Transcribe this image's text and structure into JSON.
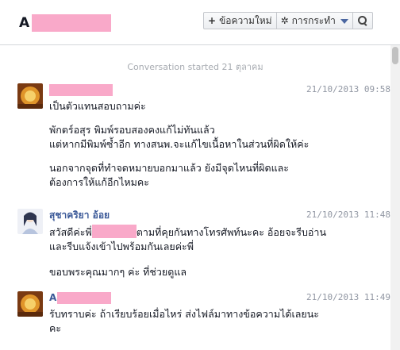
{
  "header": {
    "title_initial": "A",
    "new_message_label": "ข้อความใหม่",
    "actions_label": "การกระทำ"
  },
  "thread": {
    "conversation_started": "Conversation started 21 ตุลาคม",
    "messages": [
      {
        "sender": "",
        "timestamp": "21/10/2013 09:58",
        "paragraphs": [
          "เป็นตัวแทนสอบถามค่ะ",
          "พักตร์อสุร พิมพ์รอบสองคงแก้ไม่ทันแล้ว\nแต่หากมีพิมพ์ซ้ำอีก ทางสนพ.จะแก้ไขเนื้อหาในส่วนที่ผิดให้ค่ะ",
          "นอกจากจุดที่ทำจดหมายบอกมาแล้ว ยังมีจุดไหนที่ผิดและ\nต้องการให้แก้อีกไหมคะ"
        ]
      },
      {
        "sender": "สุชาคริยา อ้อย",
        "timestamp": "21/10/2013 11:48",
        "line1_before": "สวัสดีค่ะพี่",
        "line1_after": "ตามที่คุยกันทางโทรศัพท์นะคะ อ้อยจะรีบอ่าน",
        "line2": "และรีบแจ้งเข้าไปพร้อมกันเลยค่ะพี่",
        "para2": "ขอบพระคุณมากๆ ค่ะ ที่ช่วยดูแล"
      },
      {
        "sender_initial": "A",
        "timestamp": "21/10/2013 11:49",
        "paragraphs": [
          "รับทราบค่ะ ถ้าเรียบร้อยเมื่อไหร่ ส่งไฟล์มาทางข้อความได้เลยนะ\nคะ"
        ]
      }
    ]
  }
}
